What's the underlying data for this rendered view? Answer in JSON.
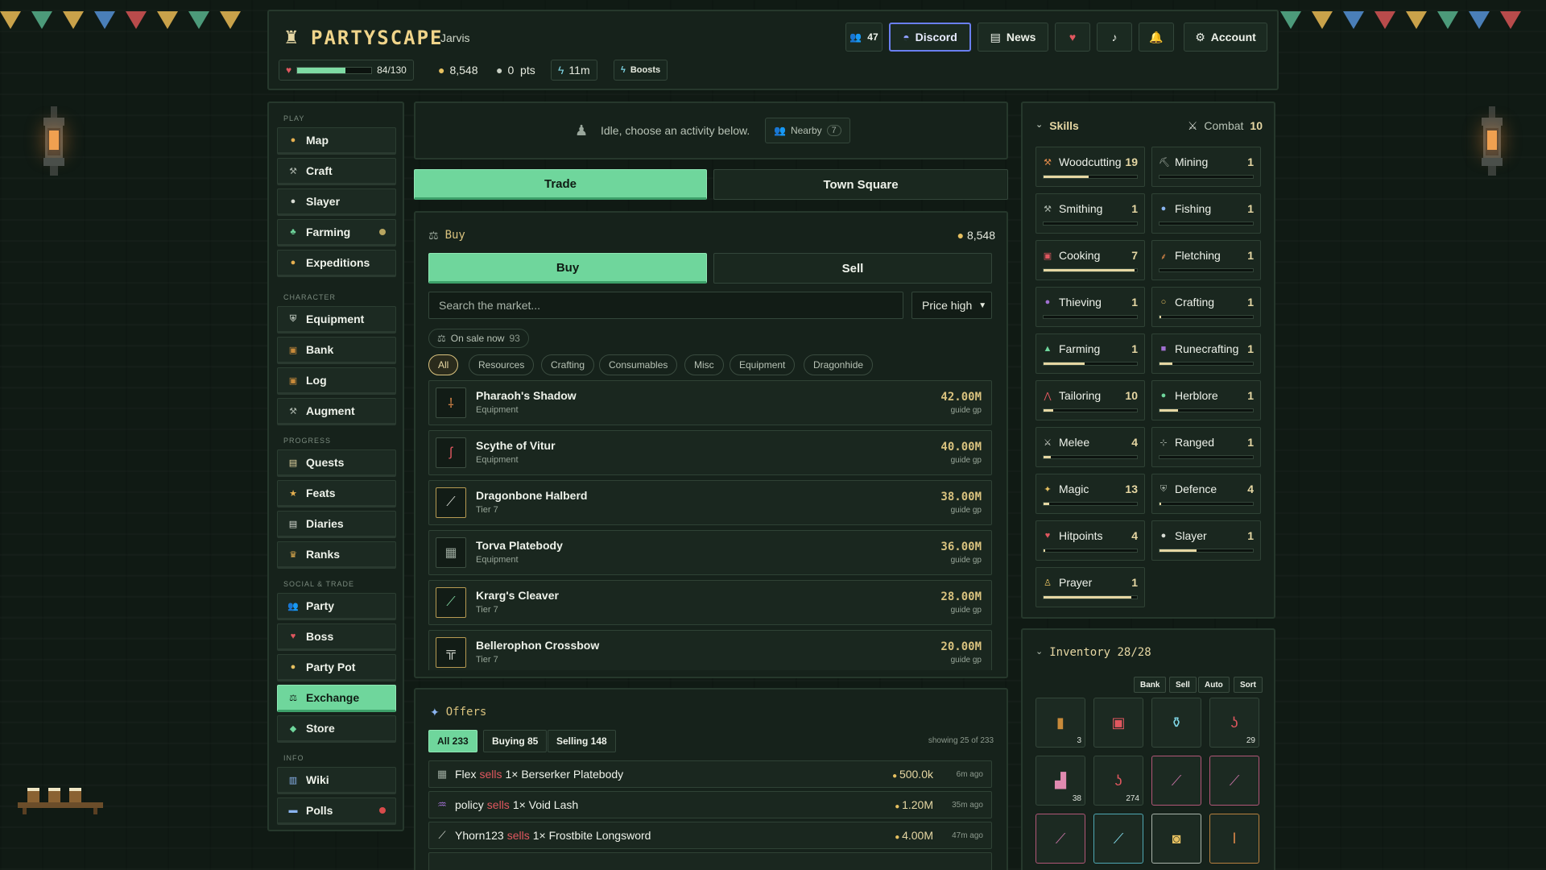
{
  "header": {
    "logo": "PARTYSCAPE",
    "username": "Jarvis",
    "online_count": "47",
    "discord": "Discord",
    "news": "News",
    "account": "Account",
    "hp_text": "84/130",
    "hp_fraction": 0.646,
    "gold": "8,548",
    "pts": "0  pts",
    "time": "11m",
    "boosts": "Boosts"
  },
  "sidebar": {
    "sections": {
      "play": "PLAY",
      "character": "CHARACTER",
      "progress": "PROGRESS",
      "social": "SOCIAL & TRADE",
      "info": "INFO"
    },
    "items": [
      {
        "label": "Map"
      },
      {
        "label": "Craft"
      },
      {
        "label": "Slayer"
      },
      {
        "label": "Farming"
      },
      {
        "label": "Expeditions"
      },
      {
        "label": "Equipment"
      },
      {
        "label": "Bank"
      },
      {
        "label": "Log"
      },
      {
        "label": "Augment"
      },
      {
        "label": "Quests"
      },
      {
        "label": "Feats"
      },
      {
        "label": "Diaries"
      },
      {
        "label": "Ranks"
      },
      {
        "label": "Party"
      },
      {
        "label": "Boss"
      },
      {
        "label": "Party Pot"
      },
      {
        "label": "Exchange"
      },
      {
        "label": "Store"
      },
      {
        "label": "Wiki"
      },
      {
        "label": "Polls"
      }
    ]
  },
  "activity": {
    "status": "Idle, choose an activity below.",
    "nearby_label": "Nearby",
    "nearby_count": "7"
  },
  "tabs": {
    "trade": "Trade",
    "town_square": "Town Square"
  },
  "market": {
    "title": "Buy",
    "gold": "8,548",
    "buy_tab": "Buy",
    "sell_tab": "Sell",
    "search_placeholder": "Search the market...",
    "sort": "Price high",
    "on_sale_label": "On sale now",
    "on_sale_count": "93",
    "filters": [
      "All",
      "Resources",
      "Crafting",
      "Consumables",
      "Misc",
      "Equipment",
      "Dragonhide"
    ],
    "items": [
      {
        "name": "Pharaoh's Shadow",
        "sub": "Equipment",
        "price": "42.00M",
        "guide": "guide gp"
      },
      {
        "name": "Scythe of Vitur",
        "sub": "Equipment",
        "price": "40.00M",
        "guide": "guide gp"
      },
      {
        "name": "Dragonbone Halberd",
        "sub": "Tier 7",
        "price": "38.00M",
        "guide": "guide gp"
      },
      {
        "name": "Torva Platebody",
        "sub": "Equipment",
        "price": "36.00M",
        "guide": "guide gp"
      },
      {
        "name": "Krarg's Cleaver",
        "sub": "Tier 7",
        "price": "28.00M",
        "guide": "guide gp"
      },
      {
        "name": "Bellerophon Crossbow",
        "sub": "Tier 7",
        "price": "20.00M",
        "guide": "guide gp"
      }
    ]
  },
  "offers": {
    "title": "Offers",
    "tab_all": "All 233",
    "tab_buying": "Buying 85",
    "tab_selling": "Selling 148",
    "showing": "showing 25 of 233",
    "rows": [
      {
        "user": "Flex",
        "action": "sells",
        "item": "1× Berserker Platebody",
        "price": "500.0k",
        "time": "6m ago"
      },
      {
        "user": "policy",
        "action": "sells",
        "item": "1× Void Lash",
        "price": "1.20M",
        "time": "35m ago"
      },
      {
        "user": "Yhorn123",
        "action": "sells",
        "item": "1× Frostbite Longsword",
        "price": "4.00M",
        "time": "47m ago"
      }
    ]
  },
  "skills": {
    "title": "Skills",
    "combat_label": "Combat",
    "combat_level": "10",
    "list": [
      {
        "name": "Woodcutting",
        "level": "19",
        "progress": 0.48
      },
      {
        "name": "Mining",
        "level": "1",
        "progress": 0.0
      },
      {
        "name": "Smithing",
        "level": "1",
        "progress": 0.0
      },
      {
        "name": "Fishing",
        "level": "1",
        "progress": 0.0
      },
      {
        "name": "Cooking",
        "level": "7",
        "progress": 0.97
      },
      {
        "name": "Fletching",
        "level": "1",
        "progress": 0.0
      },
      {
        "name": "Thieving",
        "level": "1",
        "progress": 0.0
      },
      {
        "name": "Crafting",
        "level": "1",
        "progress": 0.02
      },
      {
        "name": "Farming",
        "level": "1",
        "progress": 0.44
      },
      {
        "name": "Runecrafting",
        "level": "1",
        "progress": 0.14
      },
      {
        "name": "Tailoring",
        "level": "10",
        "progress": 0.1
      },
      {
        "name": "Herblore",
        "level": "1",
        "progress": 0.2
      },
      {
        "name": "Melee",
        "level": "4",
        "progress": 0.08
      },
      {
        "name": "Ranged",
        "level": "1",
        "progress": 0.0
      },
      {
        "name": "Magic",
        "level": "13",
        "progress": 0.06
      },
      {
        "name": "Defence",
        "level": "4",
        "progress": 0.02
      },
      {
        "name": "Hitpoints",
        "level": "4",
        "progress": 0.02
      },
      {
        "name": "Slayer",
        "level": "1",
        "progress": 0.4
      },
      {
        "name": "Prayer",
        "level": "1",
        "progress": 0.94
      }
    ]
  },
  "inventory": {
    "title": "Inventory 28/28",
    "bank": "Bank",
    "sell": "Sell",
    "auto": "Auto",
    "sort": "Sort",
    "slots": [
      {
        "icon": "log-icon",
        "qty": "3"
      },
      {
        "icon": "scroll-icon",
        "qty": ""
      },
      {
        "icon": "potion-icon",
        "qty": ""
      },
      {
        "icon": "shrimp-icon",
        "qty": "29"
      },
      {
        "icon": "boot-icon",
        "qty": "38"
      },
      {
        "icon": "shrimp-icon",
        "qty": "274"
      },
      {
        "icon": "wand-icon",
        "qty": ""
      },
      {
        "icon": "wand-icon",
        "qty": ""
      },
      {
        "icon": "wand-icon",
        "qty": ""
      },
      {
        "icon": "staff-icon",
        "qty": ""
      },
      {
        "icon": "helmet-icon",
        "qty": ""
      },
      {
        "icon": "spear-icon",
        "qty": ""
      }
    ]
  },
  "colors": {
    "accent_green": "#6fd69c",
    "gold": "#e6d7a3",
    "sells_red": "#e0575f",
    "discord_blue": "#6a7ff0"
  }
}
